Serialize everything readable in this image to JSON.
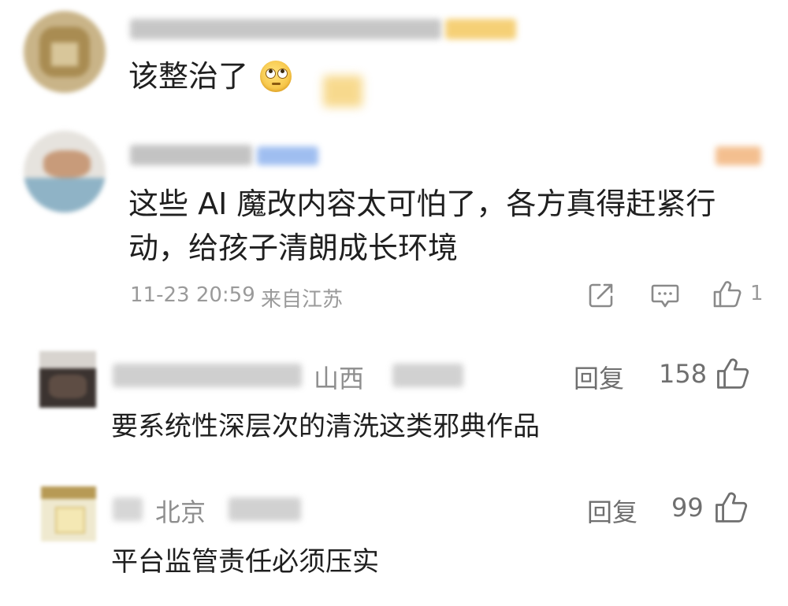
{
  "comments": [
    {
      "text": "该整治了"
    },
    {
      "text_line1": "这些 AI 魔改内容太可怕了，各方真得赶紧行",
      "text_line2": "动，给孩子清朗成长环境",
      "timestamp": "11-23 20:59",
      "origin": "来自江苏",
      "like_count": "1"
    },
    {
      "location": "山西",
      "reply_label": "回复",
      "like_count": "158",
      "text": "要系统性深层次的清洗这类邪典作品"
    },
    {
      "location": "北京",
      "reply_label": "回复",
      "like_count": "99",
      "text": "平台监管责任必须压实"
    }
  ],
  "colors": {
    "text": "#1f1f1f",
    "meta": "#9a9a9a",
    "badge_blue": "#8fb3ee",
    "badge_orange": "#f7c775"
  },
  "icons": [
    "eye-roll-emoji-icon",
    "share-icon",
    "comment-icon",
    "thumbs-up-icon"
  ]
}
